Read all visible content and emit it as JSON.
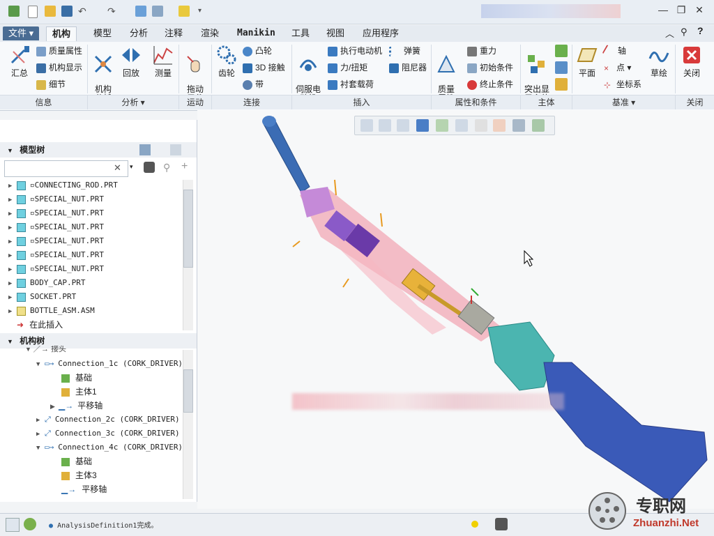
{
  "ribbon_tabs": [
    "文件",
    "机构",
    "模型",
    "分析",
    "注释",
    "渲染",
    "Manikin",
    "工具",
    "视图",
    "应用程序"
  ],
  "ribbon": {
    "huizong": "汇总",
    "zhiliang": "质量属性",
    "jigou_xianshi": "机构显示",
    "xijie": "细节",
    "jigou_fenxi": "机构\n分析",
    "huifang": "回放",
    "celiang": "测量",
    "tuodong": "拖动\n元件",
    "chilun": "齿轮",
    "tulun": "凸轮",
    "jiechu3d": "3D 接触",
    "dai": "带",
    "sifu": "伺服电\n动机",
    "zhixing": "执行电动机",
    "li_niuju": "力/扭矩",
    "chentao": "衬套载荷",
    "tanhuang": "弹簧",
    "zuniqi": "阻尼器",
    "zhiliangshuxing": "质量\n属性",
    "zhongli": "重力",
    "chushi": "初始条件",
    "zhongzhi": "终止条件",
    "tuchu": "突出显\n示主体",
    "pingmian": "平面",
    "zhou": "轴",
    "dian": "点",
    "zuobiaoxi": "坐标系",
    "caohui": "草绘",
    "guanbi": "关闭"
  },
  "groups": [
    "信息",
    "分析 ▾",
    "运动",
    "连接",
    "插入",
    "属性和条件",
    "主体",
    "基准 ▾",
    "关闭"
  ],
  "left_tabs": [
    "model-tree-tab",
    "layers-tab",
    "favorites-tab"
  ],
  "model_tree": {
    "title": "模型树",
    "items": [
      "CONNECTING_ROD.PRT",
      "SPECIAL_NUT.PRT",
      "SPECIAL_NUT.PRT",
      "SPECIAL_NUT.PRT",
      "SPECIAL_NUT.PRT",
      "SPECIAL_NUT.PRT",
      "SPECIAL_NUT.PRT",
      "BODY_CAP.PRT",
      "SOCKET.PRT",
      "BOTTLE_ASM.ASM"
    ],
    "insert_here": "在此插入"
  },
  "mech_tree": {
    "title": "机构树",
    "partial_top": "接头",
    "items": [
      {
        "text": "Connection_1c  (CORK_DRIVER)",
        "level": 1
      },
      {
        "text": "基础",
        "level": 2
      },
      {
        "text": "主体1",
        "level": 2
      },
      {
        "text": "平移轴",
        "level": 2
      },
      {
        "text": "Connection_2c  (CORK_DRIVER)",
        "level": 1
      },
      {
        "text": "Connection_3c  (CORK_DRIVER)",
        "level": 1
      },
      {
        "text": "Connection_4c  (CORK_DRIVER)",
        "level": 1
      },
      {
        "text": "基础",
        "level": 2
      },
      {
        "text": "主体3",
        "level": 2
      },
      {
        "text": "平移轴",
        "level": 2
      }
    ]
  },
  "status": {
    "message": "AnalysisDefinition1完成。"
  },
  "watermark": {
    "brand": "专职网",
    "url": "Zhuanzhi.Net"
  },
  "colors": {
    "file_tab": "#4a6c93",
    "accent": "#2f6fb0",
    "ribbon_bg": "#f7f9fb"
  }
}
